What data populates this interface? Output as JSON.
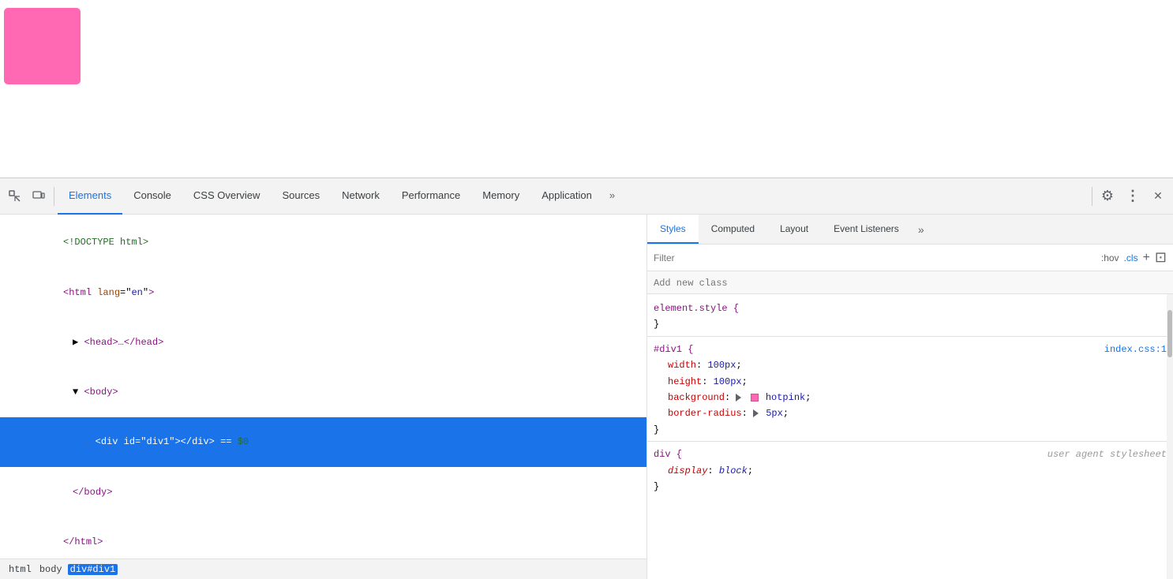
{
  "page": {
    "pink_box": "hotpink"
  },
  "devtools": {
    "toolbar": {
      "inspect_icon": "⊡",
      "device_icon": "▭",
      "tabs": [
        {
          "id": "elements",
          "label": "Elements",
          "active": true
        },
        {
          "id": "console",
          "label": "Console",
          "active": false
        },
        {
          "id": "css-overview",
          "label": "CSS Overview",
          "active": false
        },
        {
          "id": "sources",
          "label": "Sources",
          "active": false
        },
        {
          "id": "network",
          "label": "Network",
          "active": false
        },
        {
          "id": "performance",
          "label": "Performance",
          "active": false
        },
        {
          "id": "memory",
          "label": "Memory",
          "active": false
        },
        {
          "id": "application",
          "label": "Application",
          "active": false
        }
      ],
      "more_icon": "»",
      "settings_icon": "⚙",
      "kebab_icon": "⋮",
      "close_icon": "✕"
    },
    "elements_panel": {
      "lines": [
        {
          "id": "doctype",
          "text": "<!DOCTYPE html>",
          "indent": 0,
          "selected": false
        },
        {
          "id": "html-open",
          "text": "<html lang=\"en\">",
          "indent": 0,
          "selected": false
        },
        {
          "id": "head",
          "text": "▶ <head>…</head>",
          "indent": 1,
          "selected": false
        },
        {
          "id": "body-open",
          "text": "▼ <body>",
          "indent": 1,
          "selected": false
        },
        {
          "id": "div",
          "text": "<div id=\"div1\"></div> == $0",
          "indent": 2,
          "selected": true
        },
        {
          "id": "body-close",
          "text": "</body>",
          "indent": 1,
          "selected": false
        },
        {
          "id": "html-close",
          "text": "</html>",
          "indent": 0,
          "selected": false
        }
      ],
      "breadcrumb": [
        {
          "label": "html",
          "active": false
        },
        {
          "label": "body",
          "active": false
        },
        {
          "label": "div#div1",
          "active": true
        }
      ]
    },
    "styles_panel": {
      "tabs": [
        {
          "id": "styles",
          "label": "Styles",
          "active": true
        },
        {
          "id": "computed",
          "label": "Computed",
          "active": false
        },
        {
          "id": "layout",
          "label": "Layout",
          "active": false
        },
        {
          "id": "event-listeners",
          "label": "Event Listeners",
          "active": false
        }
      ],
      "more_icon": "»",
      "filter_placeholder": "Filter",
      "hov_label": ":hov",
      "cls_label": ".cls",
      "plus_label": "+",
      "arrow_label": "⊡",
      "add_class_placeholder": "Add new class",
      "rules": [
        {
          "selector": "element.style {",
          "close": "}",
          "properties": [],
          "source": ""
        },
        {
          "selector": "#div1 {",
          "close": "}",
          "source": "index.css:1",
          "properties": [
            {
              "prop": "width",
              "value": "100px"
            },
            {
              "prop": "height",
              "value": "100px"
            },
            {
              "prop": "background",
              "value": "hotpink",
              "has_swatch": true
            },
            {
              "prop": "border-radius",
              "value": "5px",
              "has_triangle": true
            }
          ]
        },
        {
          "selector": "div {",
          "close": "}",
          "source": "user agent stylesheet",
          "source_italic": true,
          "properties": [
            {
              "prop": "display",
              "value": "block",
              "italic": true
            }
          ]
        }
      ]
    }
  }
}
